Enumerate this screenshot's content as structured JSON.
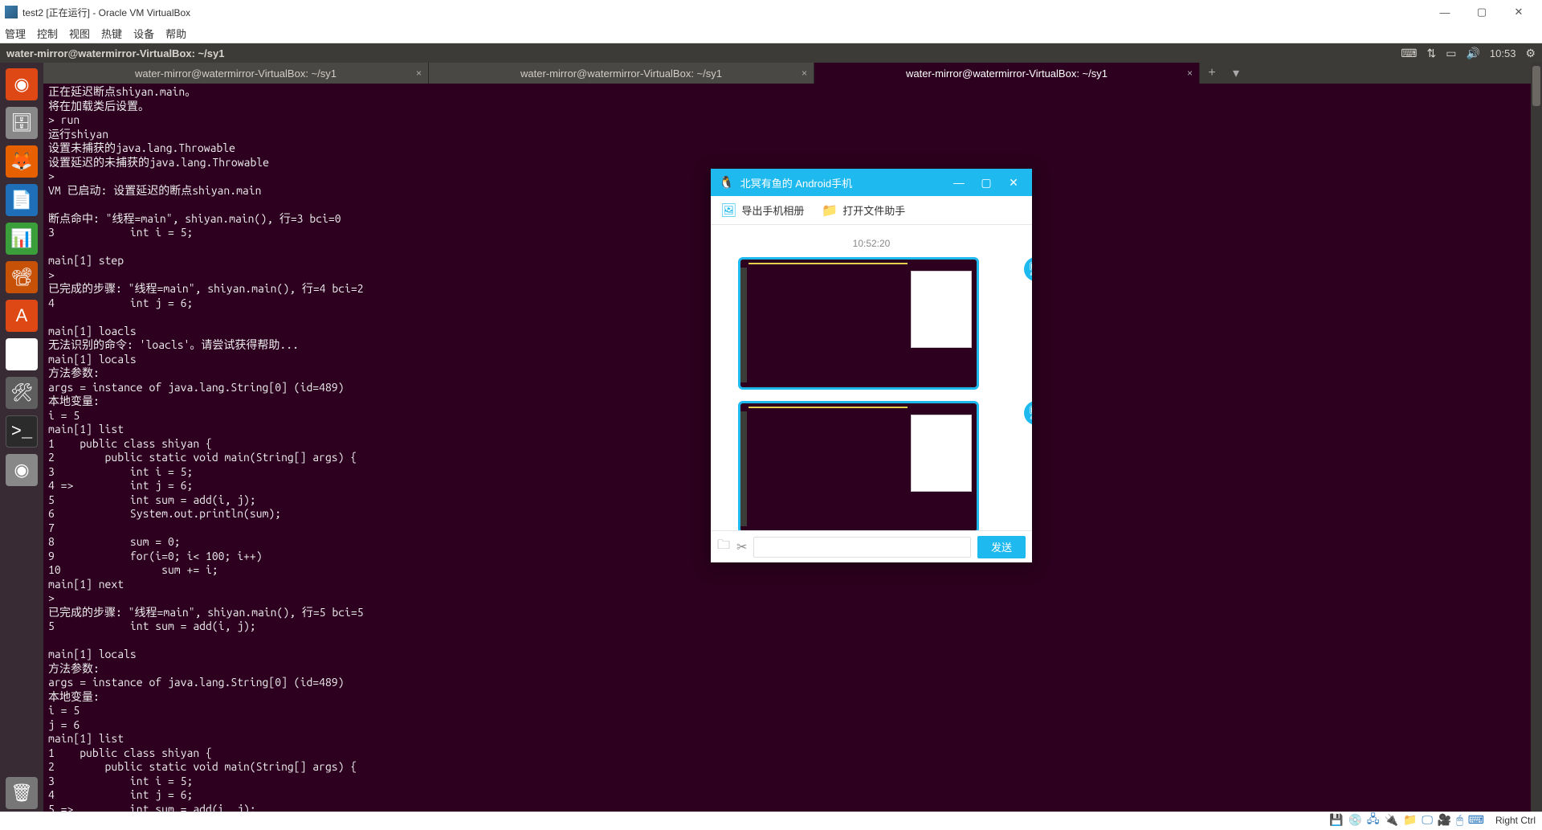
{
  "host": {
    "title": "test2 [正在运行] - Oracle VM VirtualBox",
    "menu": [
      "管理",
      "控制",
      "视图",
      "热键",
      "设备",
      "帮助"
    ],
    "statusHotkey": "Right Ctrl"
  },
  "guest": {
    "topbarPath": "water-mirror@watermirror-VirtualBox: ~/sy1",
    "clock": "10:53",
    "tabs": [
      {
        "label": "water-mirror@watermirror-VirtualBox: ~/sy1",
        "active": false
      },
      {
        "label": "water-mirror@watermirror-VirtualBox: ~/sy1",
        "active": false
      },
      {
        "label": "water-mirror@watermirror-VirtualBox: ~/sy1",
        "active": true
      }
    ],
    "terminal": "正在延迟断点shiyan.main。\n将在加载类后设置。\n> run\n运行shiyan\n设置未捕获的java.lang.Throwable\n设置延迟的未捕获的java.lang.Throwable\n>\nVM 已启动: 设置延迟的断点shiyan.main\n\n断点命中: \"线程=main\", shiyan.main(), 行=3 bci=0\n3            int i = 5;\n\nmain[1] step\n>\n已完成的步骤: \"线程=main\", shiyan.main(), 行=4 bci=2\n4            int j = 6;\n\nmain[1] loacls\n无法识别的命令: 'loacls'。请尝试获得帮助...\nmain[1] locals\n方法参数:\nargs = instance of java.lang.String[0] (id=489)\n本地变量:\ni = 5\nmain[1] list\n1    public class shiyan {\n2        public static void main(String[] args) {\n3            int i = 5;\n4 =>         int j = 6;\n5            int sum = add(i, j);\n6            System.out.println(sum);\n7\n8            sum = 0;\n9            for(i=0; i< 100; i++)\n10                sum += i;\nmain[1] next\n>\n已完成的步骤: \"线程=main\", shiyan.main(), 行=5 bci=5\n5            int sum = add(i, j);\n\nmain[1] locals\n方法参数:\nargs = instance of java.lang.String[0] (id=489)\n本地变量:\ni = 5\nj = 6\nmain[1] list\n1    public class shiyan {\n2        public static void main(String[] args) {\n3            int i = 5;\n4            int j = 6;\n5 =>         int sum = add(i, j);"
  },
  "qq": {
    "title": "北冥有鱼的 Android手机",
    "toolbar": {
      "export": "导出手机相册",
      "open": "打开文件助手"
    },
    "timestamp": "10:52:20",
    "send": "发送"
  }
}
